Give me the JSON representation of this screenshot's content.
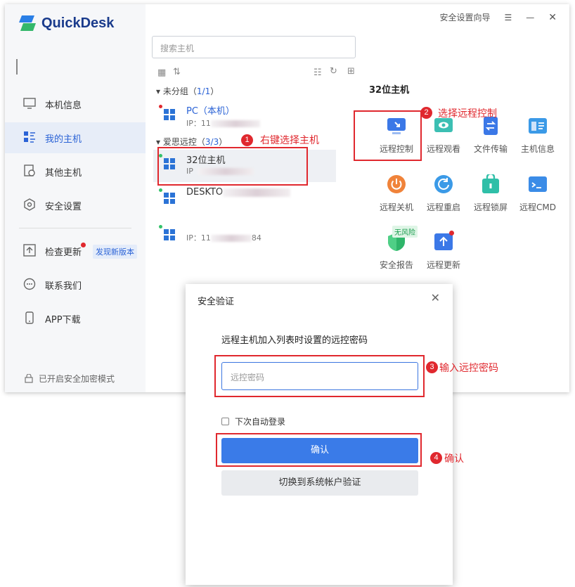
{
  "app": {
    "name": "QuickDesk",
    "brand_color": "#1a3b8c",
    "accent": "#2b63d6"
  },
  "header": {
    "wizard": "安全设置向导",
    "menu_icon": "menu-icon",
    "minimize_icon": "minimize-icon",
    "close_icon": "close-icon"
  },
  "sidebar": {
    "items": [
      {
        "label": "本机信息",
        "icon": "monitor-icon"
      },
      {
        "label": "我的主机",
        "icon": "host-list-icon"
      },
      {
        "label": "其他主机",
        "icon": "history-icon"
      },
      {
        "label": "安全设置",
        "icon": "shield-icon"
      },
      {
        "label": "检查更新",
        "icon": "upload-icon"
      },
      {
        "label": "联系我们",
        "icon": "chat-icon"
      },
      {
        "label": "APP下载",
        "icon": "phone-icon"
      }
    ],
    "update_badge": "发现新版本",
    "security_status": "已开启安全加密模式"
  },
  "search": {
    "placeholder": "搜索主机"
  },
  "groups": [
    {
      "name": "未分组",
      "count": "1/1"
    },
    {
      "name": "爱思远控",
      "count": "3/3"
    }
  ],
  "hosts": [
    {
      "name": "PC（本机）",
      "ip": "IP：11",
      "ip_tail": "",
      "status_color": "#e0282e"
    },
    {
      "name": "32位主机",
      "ip": "IP",
      "ip_tail": "",
      "status_color": "#33c26a"
    },
    {
      "name": "DESKTO",
      "ip": "",
      "ip_tail": "",
      "status_color": "#33c26a"
    },
    {
      "name": "",
      "ip": "IP：11",
      "ip_tail": "84",
      "status_color": "#33c26a"
    }
  ],
  "panel": {
    "title": "32位主机",
    "actions": [
      {
        "label": "远程控制",
        "color": "#3b78e7"
      },
      {
        "label": "远程观看",
        "color": "#3cbfb3"
      },
      {
        "label": "文件传输",
        "color": "#3b78e7"
      },
      {
        "label": "主机信息",
        "color": "#3b9ae7"
      },
      {
        "label": "远程关机",
        "color": "#f0833a"
      },
      {
        "label": "远程重启",
        "color": "#3b9ae7"
      },
      {
        "label": "远程锁屏",
        "color": "#2fbfa8"
      },
      {
        "label": "远程CMD",
        "color": "#3b8ce7"
      },
      {
        "label": "安全报告",
        "color": "#2fb56a"
      },
      {
        "label": "远程更新",
        "color": "#3b78e7"
      }
    ],
    "risk_tag": "无风险"
  },
  "annotations": [
    {
      "num": "1",
      "text": "右键选择主机"
    },
    {
      "num": "2",
      "text": "选择远程控制"
    },
    {
      "num": "3",
      "text": "输入远控密码"
    },
    {
      "num": "4",
      "text": "确认"
    }
  ],
  "dialog": {
    "title": "安全验证",
    "description": "远程主机加入列表时设置的远控密码",
    "password_placeholder": "远控密码",
    "auto_login": "下次自动登录",
    "confirm": "确认",
    "switch": "切换到系统帐户验证"
  }
}
